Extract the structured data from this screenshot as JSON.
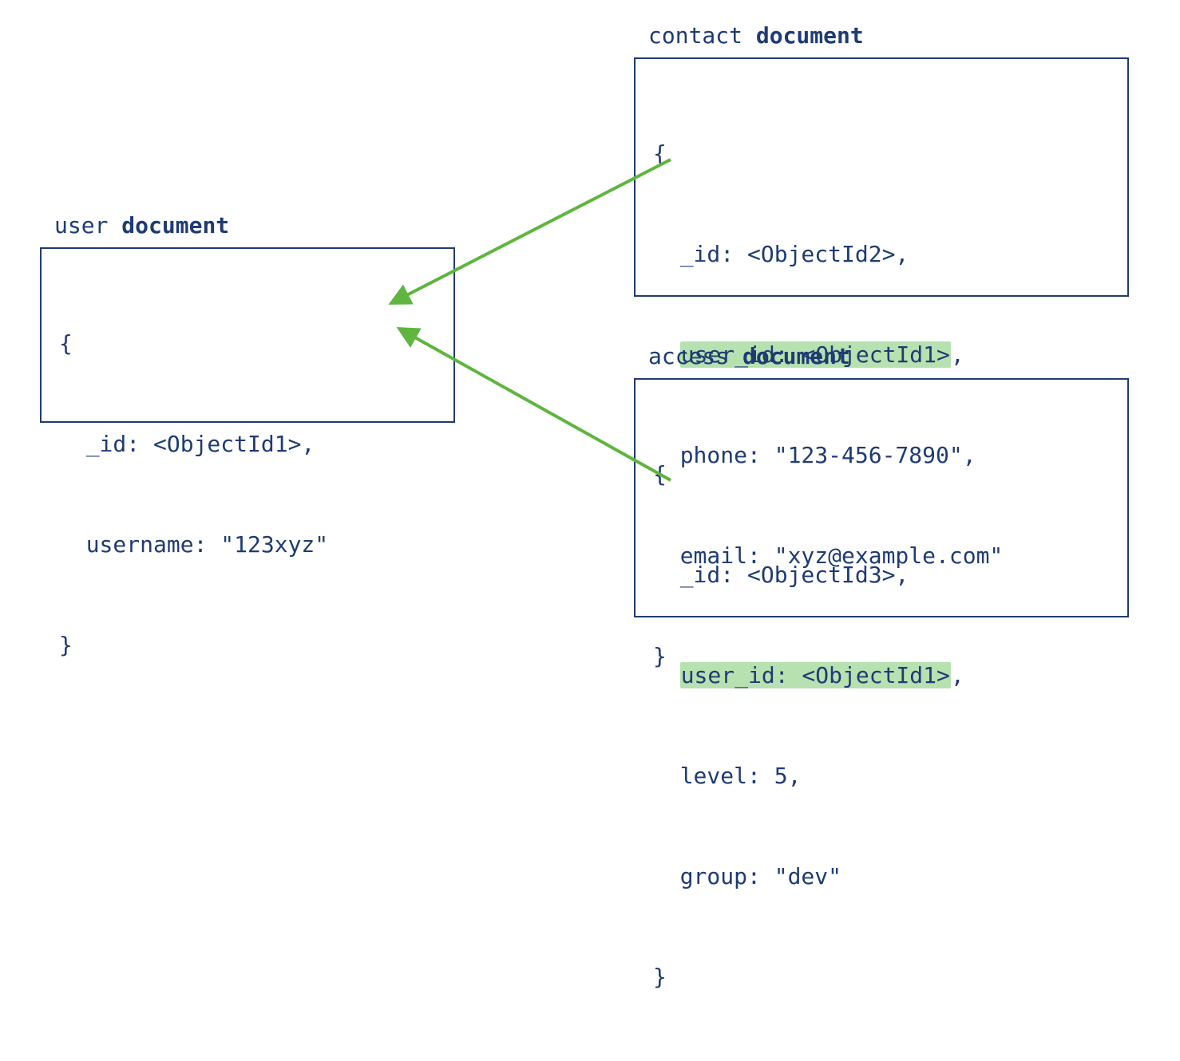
{
  "user": {
    "label_prefix": "user ",
    "label_bold": "document",
    "lines": {
      "open": "{",
      "id": "_id: <ObjectId1>,",
      "username": "username: \"123xyz\"",
      "close": "}"
    }
  },
  "contact": {
    "label_prefix": "contact ",
    "label_bold": "document",
    "lines": {
      "open": "{",
      "id": "_id: <ObjectId2>,",
      "userid": "user_id: <ObjectId1>",
      "userid_trailing": ",",
      "phone": "phone: \"123-456-7890\",",
      "email": "email: \"xyz@example.com\"",
      "close": "}"
    }
  },
  "access": {
    "label_prefix": "access ",
    "label_bold": "document",
    "lines": {
      "open": "{",
      "id": "_id: <ObjectId3>,",
      "userid": "user_id: <ObjectId1>",
      "userid_trailing": ",",
      "level": "level: 5,",
      "group": "group: \"dev\"",
      "close": "}"
    }
  }
}
